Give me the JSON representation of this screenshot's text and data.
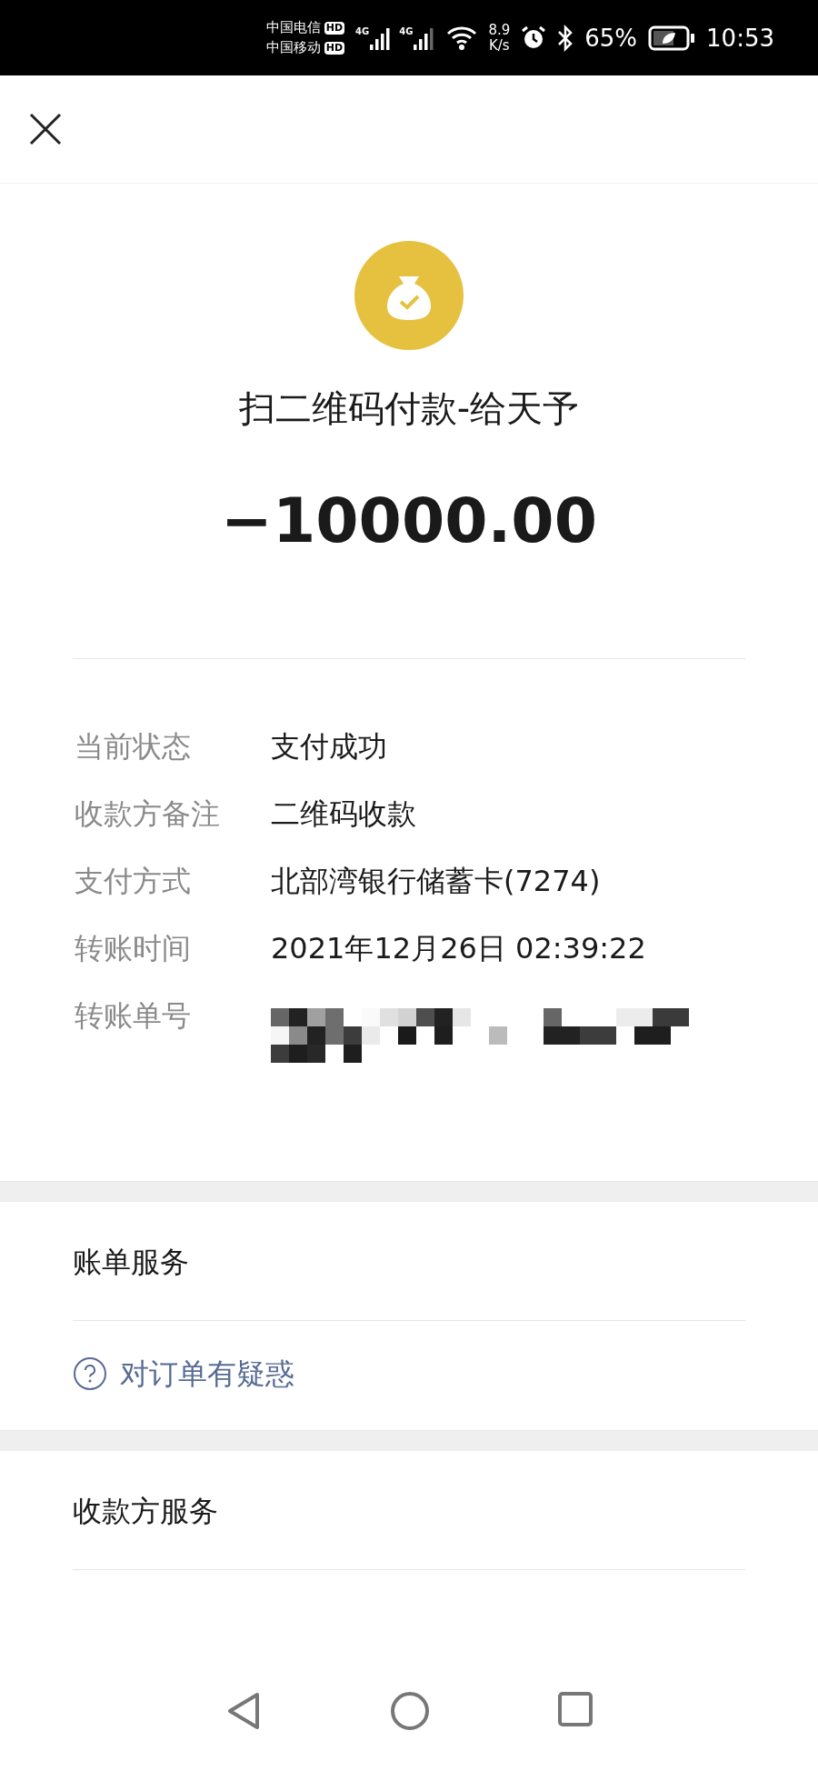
{
  "status_bar": {
    "carriers": [
      {
        "name": "中国电信",
        "badge": "HD",
        "network": "4G"
      },
      {
        "name": "中国移动",
        "badge": "HD",
        "network": "4G"
      }
    ],
    "speed_value": "8.9",
    "speed_unit": "K/s",
    "battery": "65%",
    "time": "10:53"
  },
  "payment": {
    "title": "扫二维码付款-给天予",
    "amount": "−10000.00"
  },
  "details": [
    {
      "label": "当前状态",
      "value": "支付成功",
      "kind": "text"
    },
    {
      "label": "收款方备注",
      "value": "二维码收款",
      "kind": "text"
    },
    {
      "label": "支付方式",
      "value": "北部湾银行储蓄卡(7274)",
      "kind": "text"
    },
    {
      "label": "转账时间",
      "value": "2021年12月26日 02:39:22",
      "kind": "text"
    },
    {
      "label": "转账单号",
      "kind": "redacted"
    }
  ],
  "sections": [
    {
      "title": "账单服务",
      "links": [
        {
          "label": "对订单有疑惑"
        }
      ]
    },
    {
      "title": "收款方服务"
    }
  ]
}
